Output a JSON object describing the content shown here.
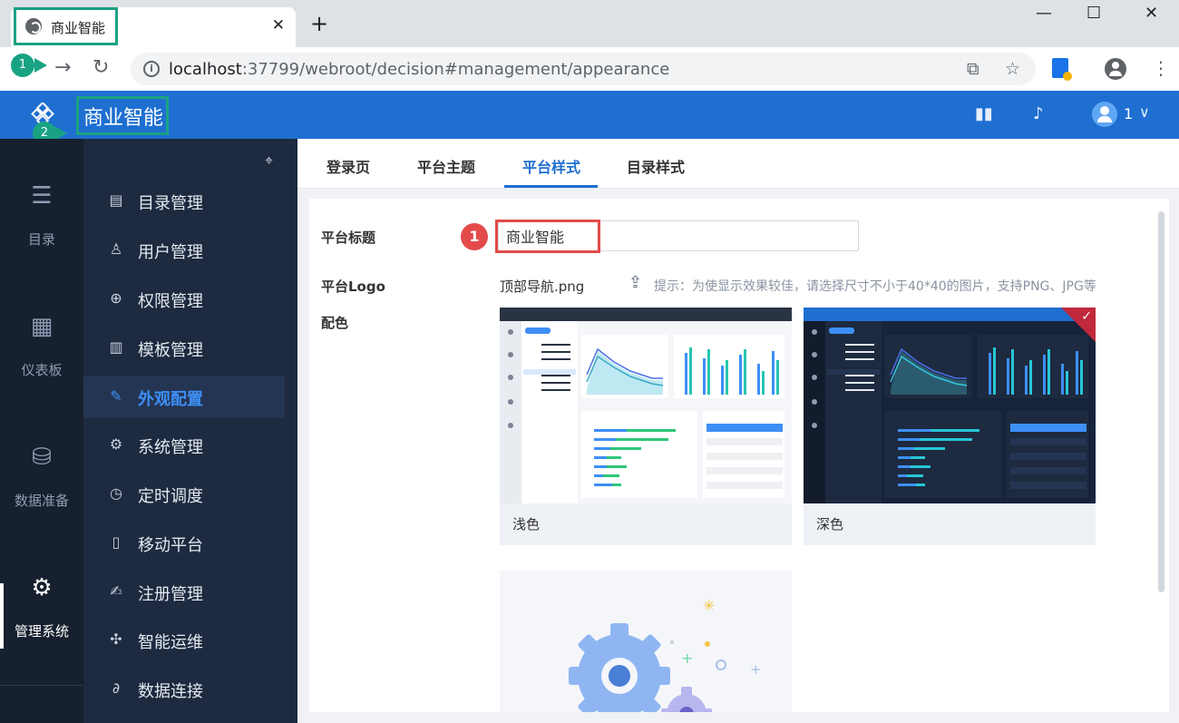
{
  "browser": {
    "tab_title": "商业智能",
    "tab_close": "✕",
    "new_tab": "+",
    "url_host": "localhost",
    "url_rest": ":37799/webroot/decision#management/appearance",
    "window_controls": [
      "—",
      "☐",
      "✕"
    ]
  },
  "annotations": {
    "step1": "1",
    "step2": "2",
    "red_step": "1"
  },
  "header": {
    "app_title": "商业智能",
    "icons": [
      "book-icon",
      "bell-icon"
    ],
    "user_name": "1"
  },
  "rail": {
    "items": [
      {
        "label": "目录",
        "icon": "list-icon"
      },
      {
        "label": "仪表板",
        "icon": "dashboard-icon"
      },
      {
        "label": "数据准备",
        "icon": "database-icon"
      },
      {
        "label": "管理系统",
        "icon": "gear-icon"
      }
    ]
  },
  "menu": {
    "items": [
      {
        "label": "目录管理",
        "icon": "catalog-icon"
      },
      {
        "label": "用户管理",
        "icon": "user-icon"
      },
      {
        "label": "权限管理",
        "icon": "lock-icon"
      },
      {
        "label": "模板管理",
        "icon": "template-icon"
      },
      {
        "label": "外观配置",
        "icon": "brush-icon"
      },
      {
        "label": "系统管理",
        "icon": "settings-icon"
      },
      {
        "label": "定时调度",
        "icon": "timer-icon"
      },
      {
        "label": "移动平台",
        "icon": "mobile-icon"
      },
      {
        "label": "注册管理",
        "icon": "register-icon"
      },
      {
        "label": "智能运维",
        "icon": "ops-icon"
      },
      {
        "label": "数据连接",
        "icon": "link-icon"
      }
    ]
  },
  "tabs": [
    "登录页",
    "平台主题",
    "平台样式",
    "目录样式"
  ],
  "form": {
    "title_label": "平台标题",
    "title_value": "商业智能",
    "logo_label": "平台Logo",
    "logo_file": "顶部导航.png",
    "hint": "提示：为使显示效果较佳，请选择尺寸不小于40*40的图片，支持PNG、JPG等",
    "color_label": "配色",
    "themes": [
      {
        "name": "浅色",
        "selected": false
      },
      {
        "name": "深色",
        "selected": true
      }
    ]
  },
  "colors": {
    "brand_blue": "#1f6fd1",
    "rail_bg": "#16202e",
    "menu_bg": "#1d2a3f",
    "annotation_green": "#19a283",
    "annotation_red": "#e34b4b"
  }
}
